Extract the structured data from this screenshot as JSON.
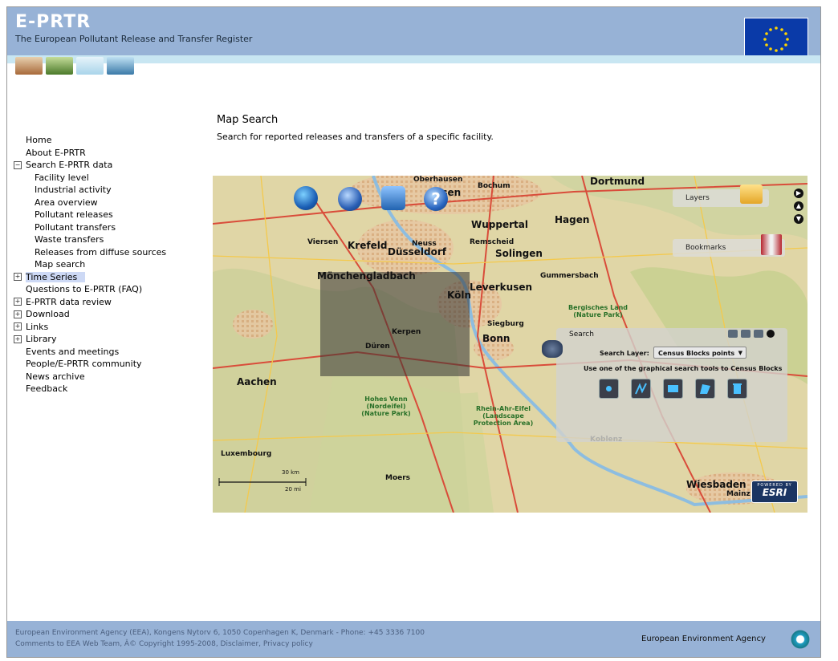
{
  "header": {
    "logo": "E-PRTR",
    "subtitle": "The European Pollutant Release and Transfer Register"
  },
  "nav": {
    "items": [
      {
        "label": "Home",
        "level": 0,
        "expander": ""
      },
      {
        "label": "About E-PRTR",
        "level": 0,
        "expander": ""
      },
      {
        "label": "Search E-PRTR data",
        "level": 0,
        "expander": "−"
      },
      {
        "label": "Facility level",
        "level": 1,
        "expander": ""
      },
      {
        "label": "Industrial activity",
        "level": 1,
        "expander": ""
      },
      {
        "label": "Area overview",
        "level": 1,
        "expander": ""
      },
      {
        "label": "Pollutant releases",
        "level": 1,
        "expander": ""
      },
      {
        "label": "Pollutant transfers",
        "level": 1,
        "expander": ""
      },
      {
        "label": "Waste transfers",
        "level": 1,
        "expander": ""
      },
      {
        "label": "Releases from diffuse sources",
        "level": 1,
        "expander": ""
      },
      {
        "label": "Map search",
        "level": 1,
        "expander": ""
      },
      {
        "label": "Time Series",
        "level": 0,
        "expander": "+",
        "selected": true
      },
      {
        "label": "Questions to E-PRTR (FAQ)",
        "level": 0,
        "expander": ""
      },
      {
        "label": "E-PRTR data review",
        "level": 0,
        "expander": "+"
      },
      {
        "label": "Download",
        "level": 0,
        "expander": "+"
      },
      {
        "label": "Links",
        "level": 0,
        "expander": "+"
      },
      {
        "label": "Library",
        "level": 0,
        "expander": "+"
      },
      {
        "label": "Events and meetings",
        "level": 0,
        "expander": ""
      },
      {
        "label": "People/E-PRTR community",
        "level": 0,
        "expander": ""
      },
      {
        "label": "News archive",
        "level": 0,
        "expander": ""
      },
      {
        "label": "Feedback",
        "level": 0,
        "expander": ""
      }
    ]
  },
  "content": {
    "title": "Map Search",
    "description": "Search for reported releases and transfers of a specific facility."
  },
  "map": {
    "labels": [
      {
        "text": "Dortmund",
        "big": true
      },
      {
        "text": "Bochum"
      },
      {
        "text": "Essen",
        "big": true
      },
      {
        "text": "Oberhausen"
      },
      {
        "text": "Düsseldorf",
        "big": true
      },
      {
        "text": "Krefeld",
        "big": true
      },
      {
        "text": "Mönchengladbach",
        "big": true
      },
      {
        "text": "Neuss"
      },
      {
        "text": "Wuppertal",
        "big": true
      },
      {
        "text": "Solingen",
        "big": true
      },
      {
        "text": "Remscheid"
      },
      {
        "text": "Leverkusen",
        "big": true
      },
      {
        "text": "Köln",
        "big": true
      },
      {
        "text": "Bonn",
        "big": true
      },
      {
        "text": "Aachen",
        "big": true
      },
      {
        "text": "Düren"
      },
      {
        "text": "Kerpen"
      },
      {
        "text": "Hagen",
        "big": true
      },
      {
        "text": "Gummersbach"
      },
      {
        "text": "Siegburg"
      },
      {
        "text": "Wiesbaden",
        "big": true
      },
      {
        "text": "Mainz"
      },
      {
        "text": "Moers"
      },
      {
        "text": "Viersen"
      },
      {
        "text": "Luxembourg"
      },
      {
        "text": "Koblenz"
      },
      {
        "text": "Hohes Venn (Nordeifel) (Nature Park)",
        "green": true
      },
      {
        "text": "Bergisches Land (Nature Park)",
        "green": true
      },
      {
        "text": "Rhein-Ahr-Eifel (Landscape Protection Area)",
        "green": true
      }
    ],
    "layers_label": "Layers",
    "bookmarks_label": "Bookmarks",
    "scale_km": "30 km",
    "scale_mi": "20 mi",
    "esri_powered": "POWERED BY",
    "esri_name": "ESRI",
    "help_glyph": "?",
    "search_panel": {
      "title": "Search",
      "layer_label": "Search Layer:",
      "layer_value": "Census Blocks points",
      "hint": "Use one of the graphical search tools to Census Blocks",
      "tools": [
        "point-tool",
        "polyline-tool",
        "rectangle-tool",
        "polygon-tool",
        "clear-tool"
      ]
    }
  },
  "footer": {
    "line1": "European Environment Agency (EEA), Kongens Nytorv 6, 1050 Copenhagen K, Denmark - Phone: +45 3336 7100",
    "line2": "Comments to EEA Web Team, Â© Copyright 1995-2008, Disclaimer, Privacy policy",
    "agency": "European Environment Agency"
  },
  "colors": {
    "header_bg": "#97b2d6",
    "map_base": "#e0d6a6",
    "selection_bg": "#cdd9f5"
  }
}
